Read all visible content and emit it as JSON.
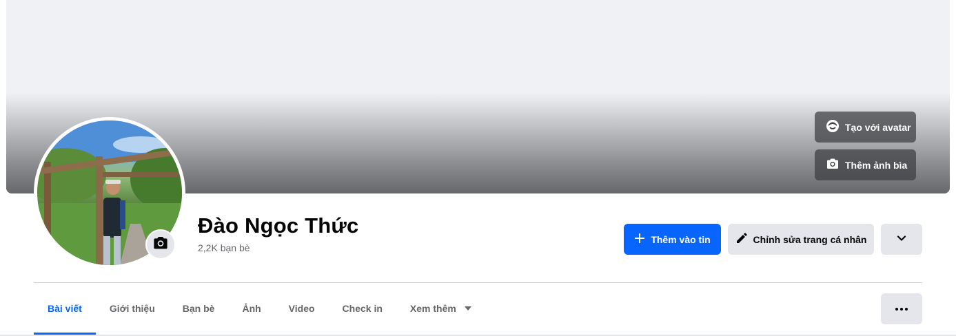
{
  "cover": {
    "create_avatar_label": "Tạo với avatar",
    "add_cover_label": "Thêm ảnh bìa"
  },
  "profile": {
    "name": "Đào Ngọc Thức",
    "friends_count": "2,2K bạn bè"
  },
  "actions": {
    "add_story_label": "Thêm vào tin",
    "edit_profile_label": "Chỉnh sửa trang cá nhân"
  },
  "tabs": [
    {
      "label": "Bài viết",
      "active": true
    },
    {
      "label": "Giới thiệu"
    },
    {
      "label": "Bạn bè"
    },
    {
      "label": "Ảnh"
    },
    {
      "label": "Video"
    },
    {
      "label": "Check in"
    },
    {
      "label": "Xem thêm"
    }
  ],
  "colors": {
    "accent": "#0866ff",
    "secondary_button": "#e4e6eb",
    "muted_text": "#65676b"
  },
  "icons": {
    "avatar_create": "avatar-face-icon",
    "add_cover": "camera-icon",
    "profile_camera": "camera-icon",
    "add_story": "plus-icon",
    "edit_profile": "pencil-icon",
    "chevron": "chevron-down-icon",
    "more": "ellipsis-icon"
  }
}
